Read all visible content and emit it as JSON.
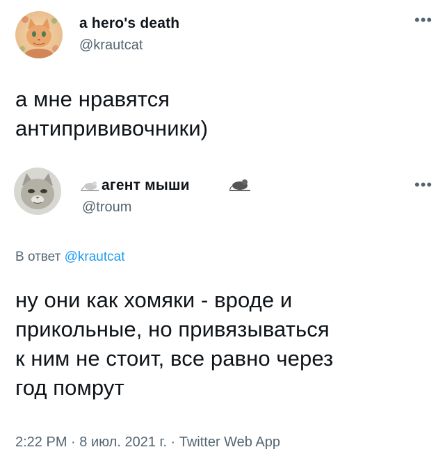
{
  "tweet1": {
    "display_name": "a hero's death",
    "handle": "@krautcat",
    "more_icon": "more-horizontal-icon",
    "text": "а мне нравятся\nантипрививочники)"
  },
  "tweet2": {
    "display_name": "агент мыши",
    "handle": "@troum",
    "more_icon": "more-horizontal-icon",
    "reply_prefix": "В ответ ",
    "reply_handle": "@krautcat",
    "text": "ну они как хомяки - вроде и\nприкольные, но привязываться\nк ним не стоит, все равно через\nгод помрут",
    "time": "2:22 PM",
    "date": "8 июл. 2021 г.",
    "source": "Twitter Web App",
    "separator": " · "
  },
  "colors": {
    "text": "#0f1419",
    "secondary": "#536471",
    "link": "#1d9bf0"
  }
}
